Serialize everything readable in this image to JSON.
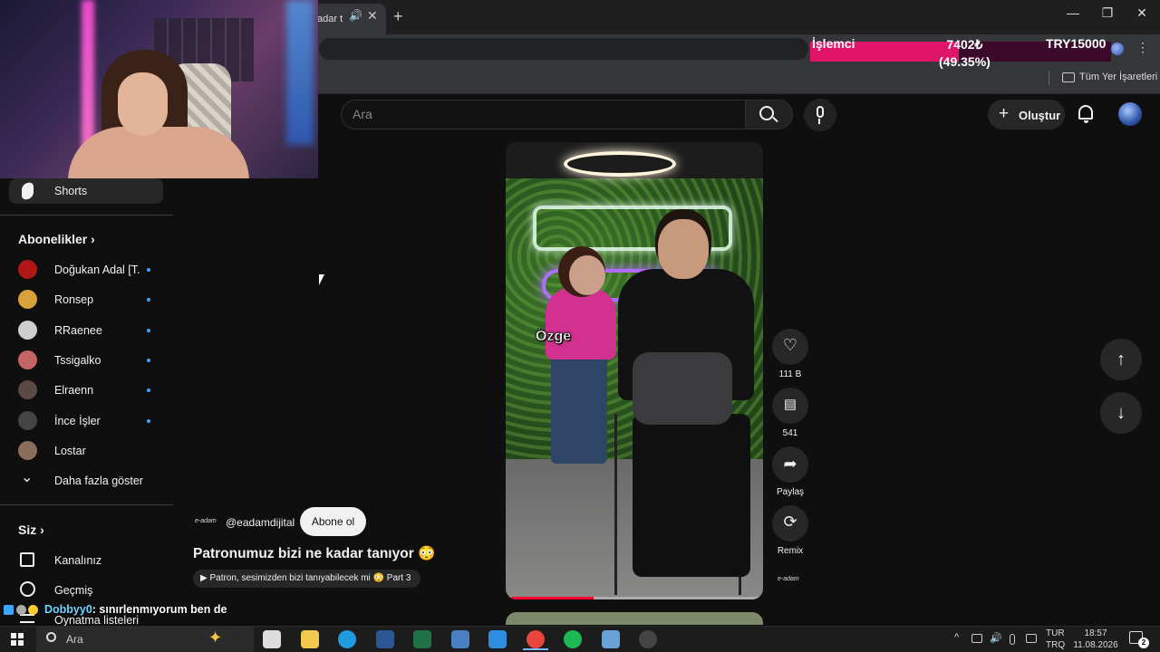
{
  "browser": {
    "tab_title": "adar t",
    "tab_close": "✕",
    "new_tab": "+",
    "window_controls": [
      "—",
      "❐",
      "✕"
    ],
    "bookmarks_label": "Tüm Yer İşaretleri",
    "menu": "⋮"
  },
  "cpu_overlay": {
    "label": "İşlemci",
    "value": "7402₺",
    "percent_text": "(49.35%)",
    "max": "TRY15000",
    "fill_fraction": 0.4935,
    "bar_color": "#e0156a"
  },
  "header": {
    "search_placeholder": "Ara",
    "create_label": "Oluştur",
    "create_plus": "+",
    "icons": [
      "search-icon",
      "mic-icon",
      "bell-icon",
      "avatar"
    ]
  },
  "sidebar": {
    "shorts_label": "Shorts",
    "subscriptions_heading": "Abonelikler",
    "subscriptions_chevron": "›",
    "subscriptions": [
      {
        "name": "Doğukan Adal [T...",
        "color": "#b01818"
      },
      {
        "name": "Ronsep",
        "color": "#d9a13a"
      },
      {
        "name": "RRaenee",
        "color": "#cfcfcf"
      },
      {
        "name": "Tssigalko",
        "color": "#c46565"
      },
      {
        "name": "Elraenn",
        "color": "#5a4a44"
      },
      {
        "name": "İnce İşler",
        "color": "#444"
      },
      {
        "name": "Lostar",
        "color": "#8a6d5b"
      }
    ],
    "show_more": "Daha fazla göster",
    "show_more_icon": "⌄",
    "you_heading": "Siz",
    "you_chevron": "›",
    "your_channel": "Kanalınız",
    "history": "Geçmiş",
    "playlists": "Oynatma listeleri"
  },
  "short": {
    "caption": "Özge",
    "progress_fraction": 0.34,
    "channel_logo_text": "e-adam",
    "channel_handle": "@eadamdijital",
    "subscribe_label": "Abone ol",
    "title": "Patronumuz bizi ne kadar tanıyor 😳",
    "playlist_text": "▶ Patron, sesimizden bizi tanıyabilecek mi 😳 Part 3",
    "actions": {
      "like_count": "111 B",
      "comment_count": "541",
      "share_label": "Paylaş",
      "remix_label": "Remix"
    },
    "nav_up": "↑",
    "nav_down": "↓"
  },
  "chat": {
    "user": "Dobbyy0",
    "message": ": sınırlenmıyorum ben de"
  },
  "taskbar": {
    "search_label": "Ara",
    "sparkle": "✦",
    "apps": [
      {
        "name": "task-view",
        "color": "#dddddd"
      },
      {
        "name": "file-explorer",
        "color": "#f2c94c"
      },
      {
        "name": "edge",
        "color": "#1f9be0"
      },
      {
        "name": "word",
        "color": "#2b5797"
      },
      {
        "name": "excel",
        "color": "#1e7145"
      },
      {
        "name": "calculator",
        "color": "#4a7fc1"
      },
      {
        "name": "store",
        "color": "#2d8de0"
      },
      {
        "name": "chrome",
        "color": "#e8453c"
      },
      {
        "name": "spotify",
        "color": "#1db954"
      },
      {
        "name": "settings",
        "color": "#6aa1d8"
      },
      {
        "name": "obs",
        "color": "#444444"
      }
    ],
    "tray_chevron": "^",
    "lang_top": "TUR",
    "lang_bottom": "TRQ",
    "time": "18:57",
    "date": "11.08.2026",
    "notifications": "2"
  }
}
